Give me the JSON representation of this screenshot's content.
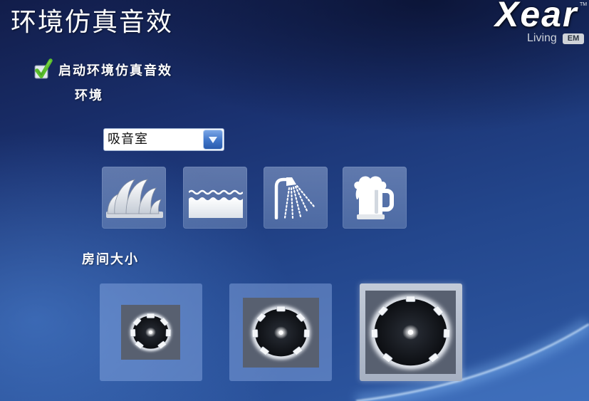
{
  "window": {
    "title": "环境仿真音效"
  },
  "logo": {
    "brand": "Xear",
    "trademark": "TM",
    "product": "Living",
    "badge": "EM"
  },
  "enable_effect": {
    "label": "启动环境仿真音效",
    "checked": true
  },
  "environment": {
    "label": "环境",
    "selected": "吸音室",
    "presets": [
      {
        "icon": "opera-house-icon"
      },
      {
        "icon": "underwater-icon"
      },
      {
        "icon": "shower-icon"
      },
      {
        "icon": "beer-mug-icon"
      }
    ]
  },
  "room_size": {
    "label": "房间大小",
    "options": [
      {
        "icon": "room-small-icon"
      },
      {
        "icon": "room-medium-icon"
      },
      {
        "icon": "room-large-icon"
      }
    ],
    "selected_index": 2
  },
  "colors": {
    "background_top": "#121d4a",
    "background_bottom": "#2f5aa5",
    "checkmark": "#5bbf2c",
    "dropdown_arrow": "#3f74c8",
    "text": "#ffffff"
  }
}
